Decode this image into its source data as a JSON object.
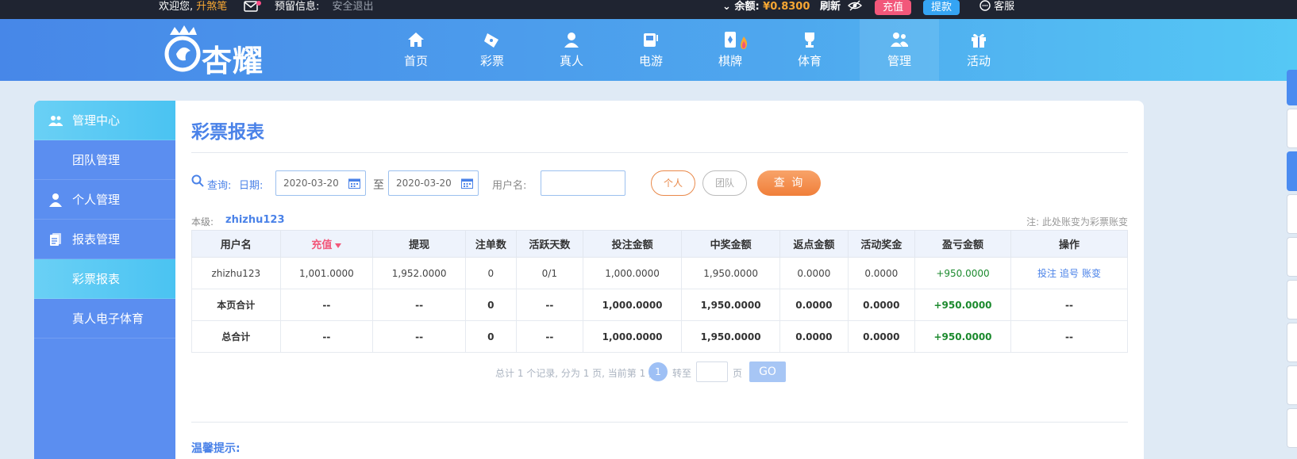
{
  "topbar": {
    "welcome_label": "欢迎您,",
    "username": "升煞笔",
    "notice_label": "预留信息:",
    "logout": "安全退出",
    "balance_label": "余额:",
    "balance": "¥0.8300",
    "refresh": "刷新",
    "recharge": "充值",
    "withdraw": "提款",
    "service": "客服"
  },
  "header": {
    "logo_text": "杏耀",
    "nav": [
      {
        "label": "首页",
        "icon": "home-icon"
      },
      {
        "label": "彩票",
        "icon": "lottery-ticket-icon"
      },
      {
        "label": "真人",
        "icon": "live-casino-icon"
      },
      {
        "label": "电游",
        "icon": "slot-machine-icon"
      },
      {
        "label": "棋牌",
        "icon": "card-game-icon"
      },
      {
        "label": "体育",
        "icon": "trophy-icon"
      },
      {
        "label": "管理",
        "icon": "users-icon"
      },
      {
        "label": "活动",
        "icon": "gift-icon"
      }
    ],
    "active_nav": "管理"
  },
  "sidebar": {
    "items": [
      {
        "label": "管理中心",
        "type": "head"
      },
      {
        "label": "团队管理",
        "type": "sub"
      },
      {
        "label": "个人管理",
        "type": "section"
      },
      {
        "label": "报表管理",
        "type": "section"
      },
      {
        "label": "彩票报表",
        "type": "sub-active"
      },
      {
        "label": "真人电子体育",
        "type": "sub"
      }
    ]
  },
  "main": {
    "title": "彩票报表",
    "query": {
      "query_label": "查询:",
      "date_label": "日期:",
      "date_from": "2020-03-20",
      "to_label": "至",
      "date_to": "2020-03-20",
      "username_label": "用户名:",
      "username_value": "",
      "personal": "个人",
      "team": "团队",
      "submit": "查 询"
    },
    "level_label": "本级:",
    "level_user": "zhizhu123",
    "note": "注: 此处账变为彩票账变",
    "table": {
      "headers": [
        "用户名",
        "充值",
        "提现",
        "注单数",
        "活跃天数",
        "投注金额",
        "中奖金额",
        "返点金额",
        "活动奖金",
        "盈亏金额",
        "操作"
      ],
      "rows": [
        [
          "zhizhu123",
          "1,001.0000",
          "1,952.0000",
          "0",
          "0/1",
          "1,000.0000",
          "1,950.0000",
          "0.0000",
          "0.0000",
          "+950.0000"
        ],
        [
          "本页合计",
          "--",
          "--",
          "0",
          "--",
          "1,000.0000",
          "1,950.0000",
          "0.0000",
          "0.0000",
          "+950.0000",
          "--"
        ],
        [
          "总合计",
          "--",
          "--",
          "0",
          "--",
          "1,000.0000",
          "1,950.0000",
          "0.0000",
          "0.0000",
          "+950.0000",
          "--"
        ]
      ],
      "row_actions": [
        "投注",
        "追号",
        "账变"
      ]
    },
    "pager": {
      "info": "总计 1 个记录, 分为 1 页, 当前第 1 页",
      "current": "1",
      "goto_label": "转至",
      "goto_value": "",
      "page_unit": "页",
      "go": "GO"
    },
    "tips_title": "温馨提示:"
  },
  "colors": {
    "brand_blue": "#4a82e8",
    "accent_orange": "#f07f3a",
    "recharge_pink": "#f2577a",
    "withdraw_blue": "#35a4f3",
    "profit_green": "#1c8a2e"
  }
}
